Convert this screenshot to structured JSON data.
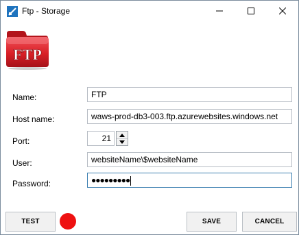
{
  "window": {
    "title": "Ftp - Storage"
  },
  "logo": {
    "text": "FTP",
    "color": "#d91f26"
  },
  "form": {
    "name_label": "Name:",
    "name_value": "FTP",
    "host_label": "Host name:",
    "host_value": "waws-prod-db3-003.ftp.azurewebsites.windows.net",
    "port_label": "Port:",
    "port_value": "21",
    "user_label": "User:",
    "user_value": "websiteName\\$websiteName",
    "password_label": "Password:",
    "password_value": "●●●●●●●●●"
  },
  "buttons": {
    "test_label": "TEST",
    "save_label": "SAVE",
    "cancel_label": "CANCEL"
  },
  "status": {
    "indicator_color": "#ee1111",
    "state": "connection-failed"
  },
  "icons": {
    "app": "ftp-storage-app-icon",
    "minimize": "minimize-icon",
    "maximize": "maximize-icon",
    "close": "close-icon",
    "spin_up": "chevron-up-icon",
    "spin_down": "chevron-down-icon"
  }
}
